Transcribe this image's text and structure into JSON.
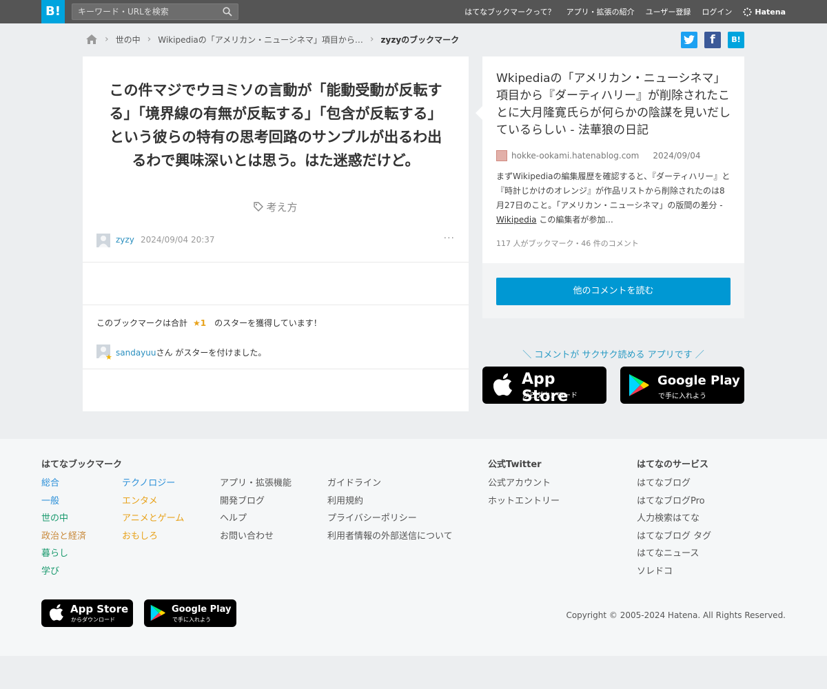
{
  "header": {
    "logo": "B!",
    "search_placeholder": "キーワード・URLを検索",
    "nav": [
      "はてなブックマークって？",
      "アプリ・拡張の紹介",
      "ユーザー登録",
      "ログイン"
    ],
    "brand": "Hatena"
  },
  "breadcrumb": {
    "items": [
      "世の中",
      "Wikipediaの「アメリカン・ニューシネマ」項目から…"
    ],
    "current": "zyzyのブックマーク"
  },
  "share": {
    "twitter": "t",
    "facebook": "f",
    "hatena": "B!"
  },
  "bookmark": {
    "comment": "この件マジでウヨミソの言動が「能動受動が反転する」「境界線の有無が反転する」「包含が反転する」という彼らの特有の思考回路のサンプルが出るわ出るわで興味深いとは思う。はた迷惑だけど。",
    "tag": "考え方",
    "username": "zyzy",
    "date": "2024/09/04 20:37",
    "more": "···"
  },
  "stars": {
    "summary_prefix": "このブックマークは合計",
    "count": "★1",
    "summary_suffix": "のスターを獲得しています！",
    "user": "sandayuu",
    "user_suffix": "さん がスターを付けました。"
  },
  "entry": {
    "title": "Wkipediaの「アメリカン・ニューシネマ」項目から『ダーティハリー』が削除されたことに大月隆寛氏らが何らかの陰謀を見いだしているらしい - 法華狼の日記",
    "domain": "hokke-ookami.hatenablog.com",
    "date": "2024/09/04",
    "desc_before": "まずWikipediaの編集履歴を確認すると、『ダーティハリー』と『時計じかけのオレンジ』が作品リストから削除されたのは8月27日のこと。「アメリカン・ニューシネマ」の版間の差分 - ",
    "desc_link": "Wikipedia",
    "desc_after": " この編集者が参加...",
    "stats": "117 人がブックマーク・46 件のコメント",
    "read_more": "他のコメントを読む"
  },
  "promo": {
    "text": "＼ コメントが サクサク読める アプリです ／",
    "appstore_big": "App Store",
    "appstore_small": "からダウンロード",
    "googleplay_big": "Google Play",
    "googleplay_small": "で手に入れよう"
  },
  "footer": {
    "bookmark_heading": "はてなブックマーク",
    "col1": [
      "総合",
      "一般",
      "世の中",
      "政治と経済",
      "暮らし",
      "学び"
    ],
    "col2": [
      "テクノロジー",
      "エンタメ",
      "アニメとゲーム",
      "おもしろ"
    ],
    "col3": [
      "アプリ・拡張機能",
      "開発ブログ",
      "ヘルプ",
      "お問い合わせ"
    ],
    "col4": [
      "ガイドライン",
      "利用規約",
      "プライバシーポリシー",
      "利用者情報の外部送信について"
    ],
    "twitter_heading": "公式Twitter",
    "twitter": [
      "公式アカウント",
      "ホットエントリー"
    ],
    "services_heading": "はてなのサービス",
    "services": [
      "はてなブログ",
      "はてなブログPro",
      "人力検索はてな",
      "はてなブログ タグ",
      "はてなニュース",
      "ソレドコ"
    ],
    "copyright": "Copyright © 2005-2024 Hatena. All Rights Reserved.",
    "col1_colors": [
      "#2a8fd8",
      "#2a8fd8",
      "#1a9a6e",
      "#c8893a",
      "#1a9a6e",
      "#1a9a6e"
    ],
    "col2_colors": [
      "#2a8fd8",
      "#e8a21a",
      "#e8a21a",
      "#e8a21a"
    ]
  },
  "colors": {
    "hatena_blue": "#00a4de",
    "twitter": "#1da1f2",
    "facebook": "#3b5998",
    "button_blue": "#0098d3"
  }
}
